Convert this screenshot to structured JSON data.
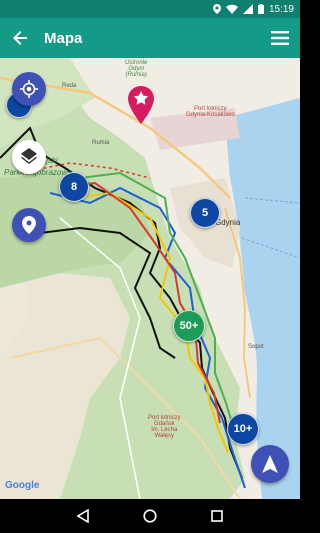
{
  "status_bar": {
    "time": "15:19"
  },
  "app_bar": {
    "title": "Mapa"
  },
  "map": {
    "labels": {
      "reda": "Reda",
      "rumia_top": "Rumia",
      "rumia_small": "Ustronie\nGdyni\n(Rumia)",
      "rumia": "Rumia",
      "gdynia": "Gdynia",
      "sopot": "Sopot",
      "trojmiejski": "Trójmiejski",
      "park_krajobrazowy": "Park Krajobrazowy",
      "port_gdynia": "Port lotniczy\nGdynia-Kosakowo",
      "port_gdansk": "Port lotniczy\nGdańsk\nim. Lecha\nWałęsy"
    },
    "clusters": {
      "c8": "8",
      "c5": "5",
      "c50": "50+",
      "c10": "10+"
    },
    "attribution": "Google"
  },
  "colors": {
    "app_bar": "#139b87",
    "status_bar": "#0f7f70",
    "fab_blue": "#3f51b5",
    "cluster_blue": "#0d47a1",
    "cluster_green": "#1e9b57",
    "marker_pink": "#d81b60"
  },
  "icons": {
    "back": "arrow-left-icon",
    "menu": "hamburger-menu-icon",
    "location": "my-location-icon",
    "layers": "layers-icon",
    "pin": "map-pin-icon",
    "navigate": "navigation-arrow-icon"
  }
}
